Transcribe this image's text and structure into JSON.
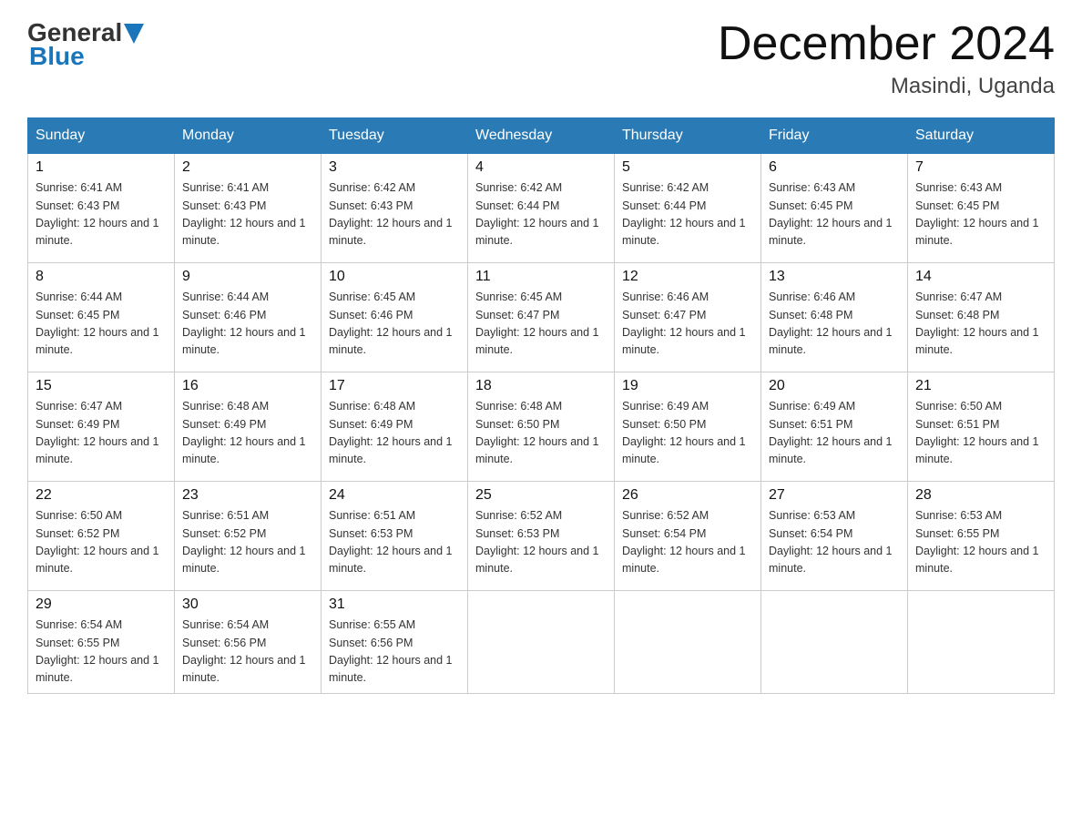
{
  "header": {
    "logo_general": "General",
    "logo_blue": "Blue",
    "title": "December 2024",
    "location": "Masindi, Uganda"
  },
  "days_of_week": [
    "Sunday",
    "Monday",
    "Tuesday",
    "Wednesday",
    "Thursday",
    "Friday",
    "Saturday"
  ],
  "weeks": [
    [
      {
        "day": "1",
        "sunrise": "6:41 AM",
        "sunset": "6:43 PM",
        "daylight": "12 hours and 1 minute."
      },
      {
        "day": "2",
        "sunrise": "6:41 AM",
        "sunset": "6:43 PM",
        "daylight": "12 hours and 1 minute."
      },
      {
        "day": "3",
        "sunrise": "6:42 AM",
        "sunset": "6:43 PM",
        "daylight": "12 hours and 1 minute."
      },
      {
        "day": "4",
        "sunrise": "6:42 AM",
        "sunset": "6:44 PM",
        "daylight": "12 hours and 1 minute."
      },
      {
        "day": "5",
        "sunrise": "6:42 AM",
        "sunset": "6:44 PM",
        "daylight": "12 hours and 1 minute."
      },
      {
        "day": "6",
        "sunrise": "6:43 AM",
        "sunset": "6:45 PM",
        "daylight": "12 hours and 1 minute."
      },
      {
        "day": "7",
        "sunrise": "6:43 AM",
        "sunset": "6:45 PM",
        "daylight": "12 hours and 1 minute."
      }
    ],
    [
      {
        "day": "8",
        "sunrise": "6:44 AM",
        "sunset": "6:45 PM",
        "daylight": "12 hours and 1 minute."
      },
      {
        "day": "9",
        "sunrise": "6:44 AM",
        "sunset": "6:46 PM",
        "daylight": "12 hours and 1 minute."
      },
      {
        "day": "10",
        "sunrise": "6:45 AM",
        "sunset": "6:46 PM",
        "daylight": "12 hours and 1 minute."
      },
      {
        "day": "11",
        "sunrise": "6:45 AM",
        "sunset": "6:47 PM",
        "daylight": "12 hours and 1 minute."
      },
      {
        "day": "12",
        "sunrise": "6:46 AM",
        "sunset": "6:47 PM",
        "daylight": "12 hours and 1 minute."
      },
      {
        "day": "13",
        "sunrise": "6:46 AM",
        "sunset": "6:48 PM",
        "daylight": "12 hours and 1 minute."
      },
      {
        "day": "14",
        "sunrise": "6:47 AM",
        "sunset": "6:48 PM",
        "daylight": "12 hours and 1 minute."
      }
    ],
    [
      {
        "day": "15",
        "sunrise": "6:47 AM",
        "sunset": "6:49 PM",
        "daylight": "12 hours and 1 minute."
      },
      {
        "day": "16",
        "sunrise": "6:48 AM",
        "sunset": "6:49 PM",
        "daylight": "12 hours and 1 minute."
      },
      {
        "day": "17",
        "sunrise": "6:48 AM",
        "sunset": "6:49 PM",
        "daylight": "12 hours and 1 minute."
      },
      {
        "day": "18",
        "sunrise": "6:48 AM",
        "sunset": "6:50 PM",
        "daylight": "12 hours and 1 minute."
      },
      {
        "day": "19",
        "sunrise": "6:49 AM",
        "sunset": "6:50 PM",
        "daylight": "12 hours and 1 minute."
      },
      {
        "day": "20",
        "sunrise": "6:49 AM",
        "sunset": "6:51 PM",
        "daylight": "12 hours and 1 minute."
      },
      {
        "day": "21",
        "sunrise": "6:50 AM",
        "sunset": "6:51 PM",
        "daylight": "12 hours and 1 minute."
      }
    ],
    [
      {
        "day": "22",
        "sunrise": "6:50 AM",
        "sunset": "6:52 PM",
        "daylight": "12 hours and 1 minute."
      },
      {
        "day": "23",
        "sunrise": "6:51 AM",
        "sunset": "6:52 PM",
        "daylight": "12 hours and 1 minute."
      },
      {
        "day": "24",
        "sunrise": "6:51 AM",
        "sunset": "6:53 PM",
        "daylight": "12 hours and 1 minute."
      },
      {
        "day": "25",
        "sunrise": "6:52 AM",
        "sunset": "6:53 PM",
        "daylight": "12 hours and 1 minute."
      },
      {
        "day": "26",
        "sunrise": "6:52 AM",
        "sunset": "6:54 PM",
        "daylight": "12 hours and 1 minute."
      },
      {
        "day": "27",
        "sunrise": "6:53 AM",
        "sunset": "6:54 PM",
        "daylight": "12 hours and 1 minute."
      },
      {
        "day": "28",
        "sunrise": "6:53 AM",
        "sunset": "6:55 PM",
        "daylight": "12 hours and 1 minute."
      }
    ],
    [
      {
        "day": "29",
        "sunrise": "6:54 AM",
        "sunset": "6:55 PM",
        "daylight": "12 hours and 1 minute."
      },
      {
        "day": "30",
        "sunrise": "6:54 AM",
        "sunset": "6:56 PM",
        "daylight": "12 hours and 1 minute."
      },
      {
        "day": "31",
        "sunrise": "6:55 AM",
        "sunset": "6:56 PM",
        "daylight": "12 hours and 1 minute."
      },
      null,
      null,
      null,
      null
    ]
  ]
}
